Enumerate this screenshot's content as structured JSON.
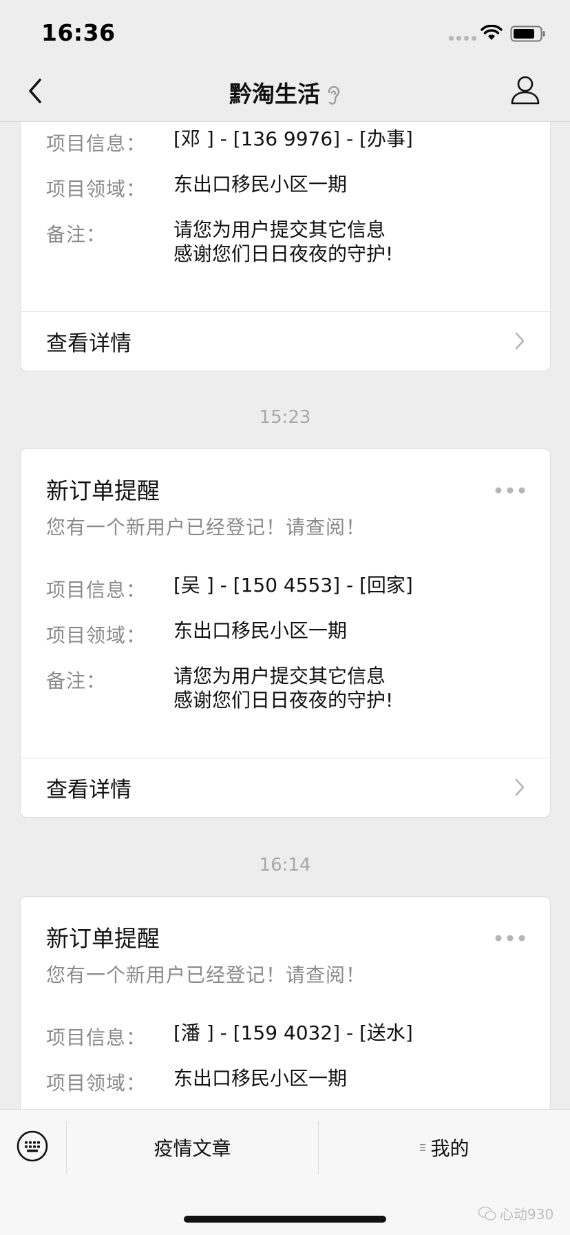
{
  "status_bar": {
    "time": "16:36"
  },
  "nav": {
    "title": "黔淘生活"
  },
  "cards": [
    {
      "title": "",
      "subtitle": "",
      "rows": [
        {
          "label": "项目信息：",
          "value": [
            "[邓  ] - [136  9976] - [办事]"
          ]
        },
        {
          "label": "项目领域：",
          "value": [
            "东出口移民小区一期"
          ]
        },
        {
          "label": "备注：",
          "value": [
            "请您为用户提交其它信息",
            "感谢您们日日夜夜的守护!"
          ]
        }
      ],
      "footer": "查看详情"
    },
    {
      "title": "新订单提醒",
      "subtitle": "您有一个新用户已经登记！请查阅！",
      "rows": [
        {
          "label": "项目信息：",
          "value": [
            "[吴  ] - [150  4553] - [回家]"
          ]
        },
        {
          "label": "项目领域：",
          "value": [
            "东出口移民小区一期"
          ]
        },
        {
          "label": "备注：",
          "value": [
            "请您为用户提交其它信息",
            "感谢您们日日夜夜的守护!"
          ]
        }
      ],
      "footer": "查看详情"
    },
    {
      "title": "新订单提醒",
      "subtitle": "您有一个新用户已经登记！请查阅！",
      "rows": [
        {
          "label": "项目信息：",
          "value": [
            "[潘  ] - [159  4032] - [送水]"
          ]
        },
        {
          "label": "项目领域：",
          "value": [
            "东出口移民小区一期"
          ]
        }
      ],
      "footer": ""
    }
  ],
  "times": [
    "15:23",
    "16:14"
  ],
  "bottom_menu": {
    "items": [
      "疫情文章",
      "我的"
    ]
  },
  "watermark": "心动930",
  "colors": {
    "background": "#ededed",
    "card": "#ffffff",
    "muted_text": "#8a8a8a",
    "time_text": "#a8a8a8"
  }
}
